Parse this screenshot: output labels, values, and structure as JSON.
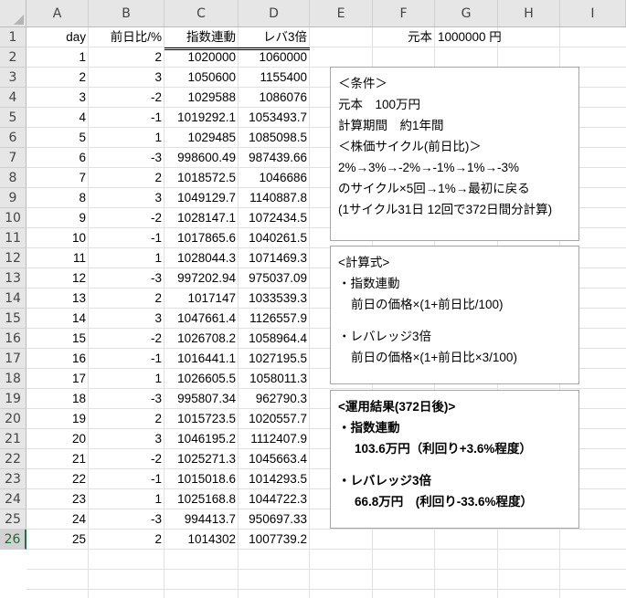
{
  "columns": [
    "A",
    "B",
    "C",
    "D",
    "E",
    "F",
    "G",
    "H",
    "I"
  ],
  "header_row": {
    "a": "day",
    "b": "前日比/%",
    "c": "指数連動",
    "d": "レバ3倍",
    "f": "元本",
    "g": "1000000 円"
  },
  "rows": [
    {
      "n": "2",
      "a": "1",
      "b": "2",
      "c": "1020000",
      "d": "1060000"
    },
    {
      "n": "3",
      "a": "2",
      "b": "3",
      "c": "1050600",
      "d": "1155400"
    },
    {
      "n": "4",
      "a": "3",
      "b": "-2",
      "c": "1029588",
      "d": "1086076"
    },
    {
      "n": "5",
      "a": "4",
      "b": "-1",
      "c": "1019292.1",
      "d": "1053493.7"
    },
    {
      "n": "6",
      "a": "5",
      "b": "1",
      "c": "1029485",
      "d": "1085098.5"
    },
    {
      "n": "7",
      "a": "6",
      "b": "-3",
      "c": "998600.49",
      "d": "987439.66"
    },
    {
      "n": "8",
      "a": "7",
      "b": "2",
      "c": "1018572.5",
      "d": "1046686"
    },
    {
      "n": "9",
      "a": "8",
      "b": "3",
      "c": "1049129.7",
      "d": "1140887.8"
    },
    {
      "n": "10",
      "a": "9",
      "b": "-2",
      "c": "1028147.1",
      "d": "1072434.5"
    },
    {
      "n": "11",
      "a": "10",
      "b": "-1",
      "c": "1017865.6",
      "d": "1040261.5"
    },
    {
      "n": "12",
      "a": "11",
      "b": "1",
      "c": "1028044.3",
      "d": "1071469.3"
    },
    {
      "n": "13",
      "a": "12",
      "b": "-3",
      "c": "997202.94",
      "d": "975037.09"
    },
    {
      "n": "14",
      "a": "13",
      "b": "2",
      "c": "1017147",
      "d": "1033539.3"
    },
    {
      "n": "15",
      "a": "14",
      "b": "3",
      "c": "1047661.4",
      "d": "1126557.9"
    },
    {
      "n": "16",
      "a": "15",
      "b": "-2",
      "c": "1026708.2",
      "d": "1058964.4"
    },
    {
      "n": "17",
      "a": "16",
      "b": "-1",
      "c": "1016441.1",
      "d": "1027195.5"
    },
    {
      "n": "18",
      "a": "17",
      "b": "1",
      "c": "1026605.5",
      "d": "1058011.3"
    },
    {
      "n": "19",
      "a": "18",
      "b": "-3",
      "c": "995807.34",
      "d": "962790.3"
    },
    {
      "n": "20",
      "a": "19",
      "b": "2",
      "c": "1015723.5",
      "d": "1020557.7"
    },
    {
      "n": "21",
      "a": "20",
      "b": "3",
      "c": "1046195.2",
      "d": "1112407.9"
    },
    {
      "n": "22",
      "a": "21",
      "b": "-2",
      "c": "1025271.3",
      "d": "1045663.4"
    },
    {
      "n": "23",
      "a": "22",
      "b": "-1",
      "c": "1015018.6",
      "d": "1014293.5"
    },
    {
      "n": "24",
      "a": "23",
      "b": "1",
      "c": "1025168.8",
      "d": "1044722.3"
    },
    {
      "n": "25",
      "a": "24",
      "b": "-3",
      "c": "994413.7",
      "d": "950697.33"
    },
    {
      "n": "26",
      "a": "25",
      "b": "2",
      "c": "1014302",
      "d": "1007739.2"
    }
  ],
  "conditions_box": {
    "l1": "＜条件＞",
    "l2": "元本　100万円",
    "l3": "計算期間　約1年間",
    "l4": "＜株価サイクル(前日比)＞",
    "l5": "2%→3%→-2%→-1%→1%→-3%",
    "l6": "のサイクル×5回→1%→最初に戻る",
    "l7": "(1サイクル31日 12回で372日間分計算)"
  },
  "formula_box": {
    "l1": "<計算式>",
    "l2": "・指数連動",
    "l3": "前日の価格×(1+前日比/100)",
    "l4": "・レバレッジ3倍",
    "l5": "前日の価格×(1+前日比×3/100)"
  },
  "result_box": {
    "l1": "<運用結果(372日後)>",
    "l2": "・指数連動",
    "l3": "103.6万円（利回り+3.6%程度）",
    "l4": "・レバレッジ3倍",
    "l5": "66.8万円　(利回り-33.6%程度）"
  }
}
